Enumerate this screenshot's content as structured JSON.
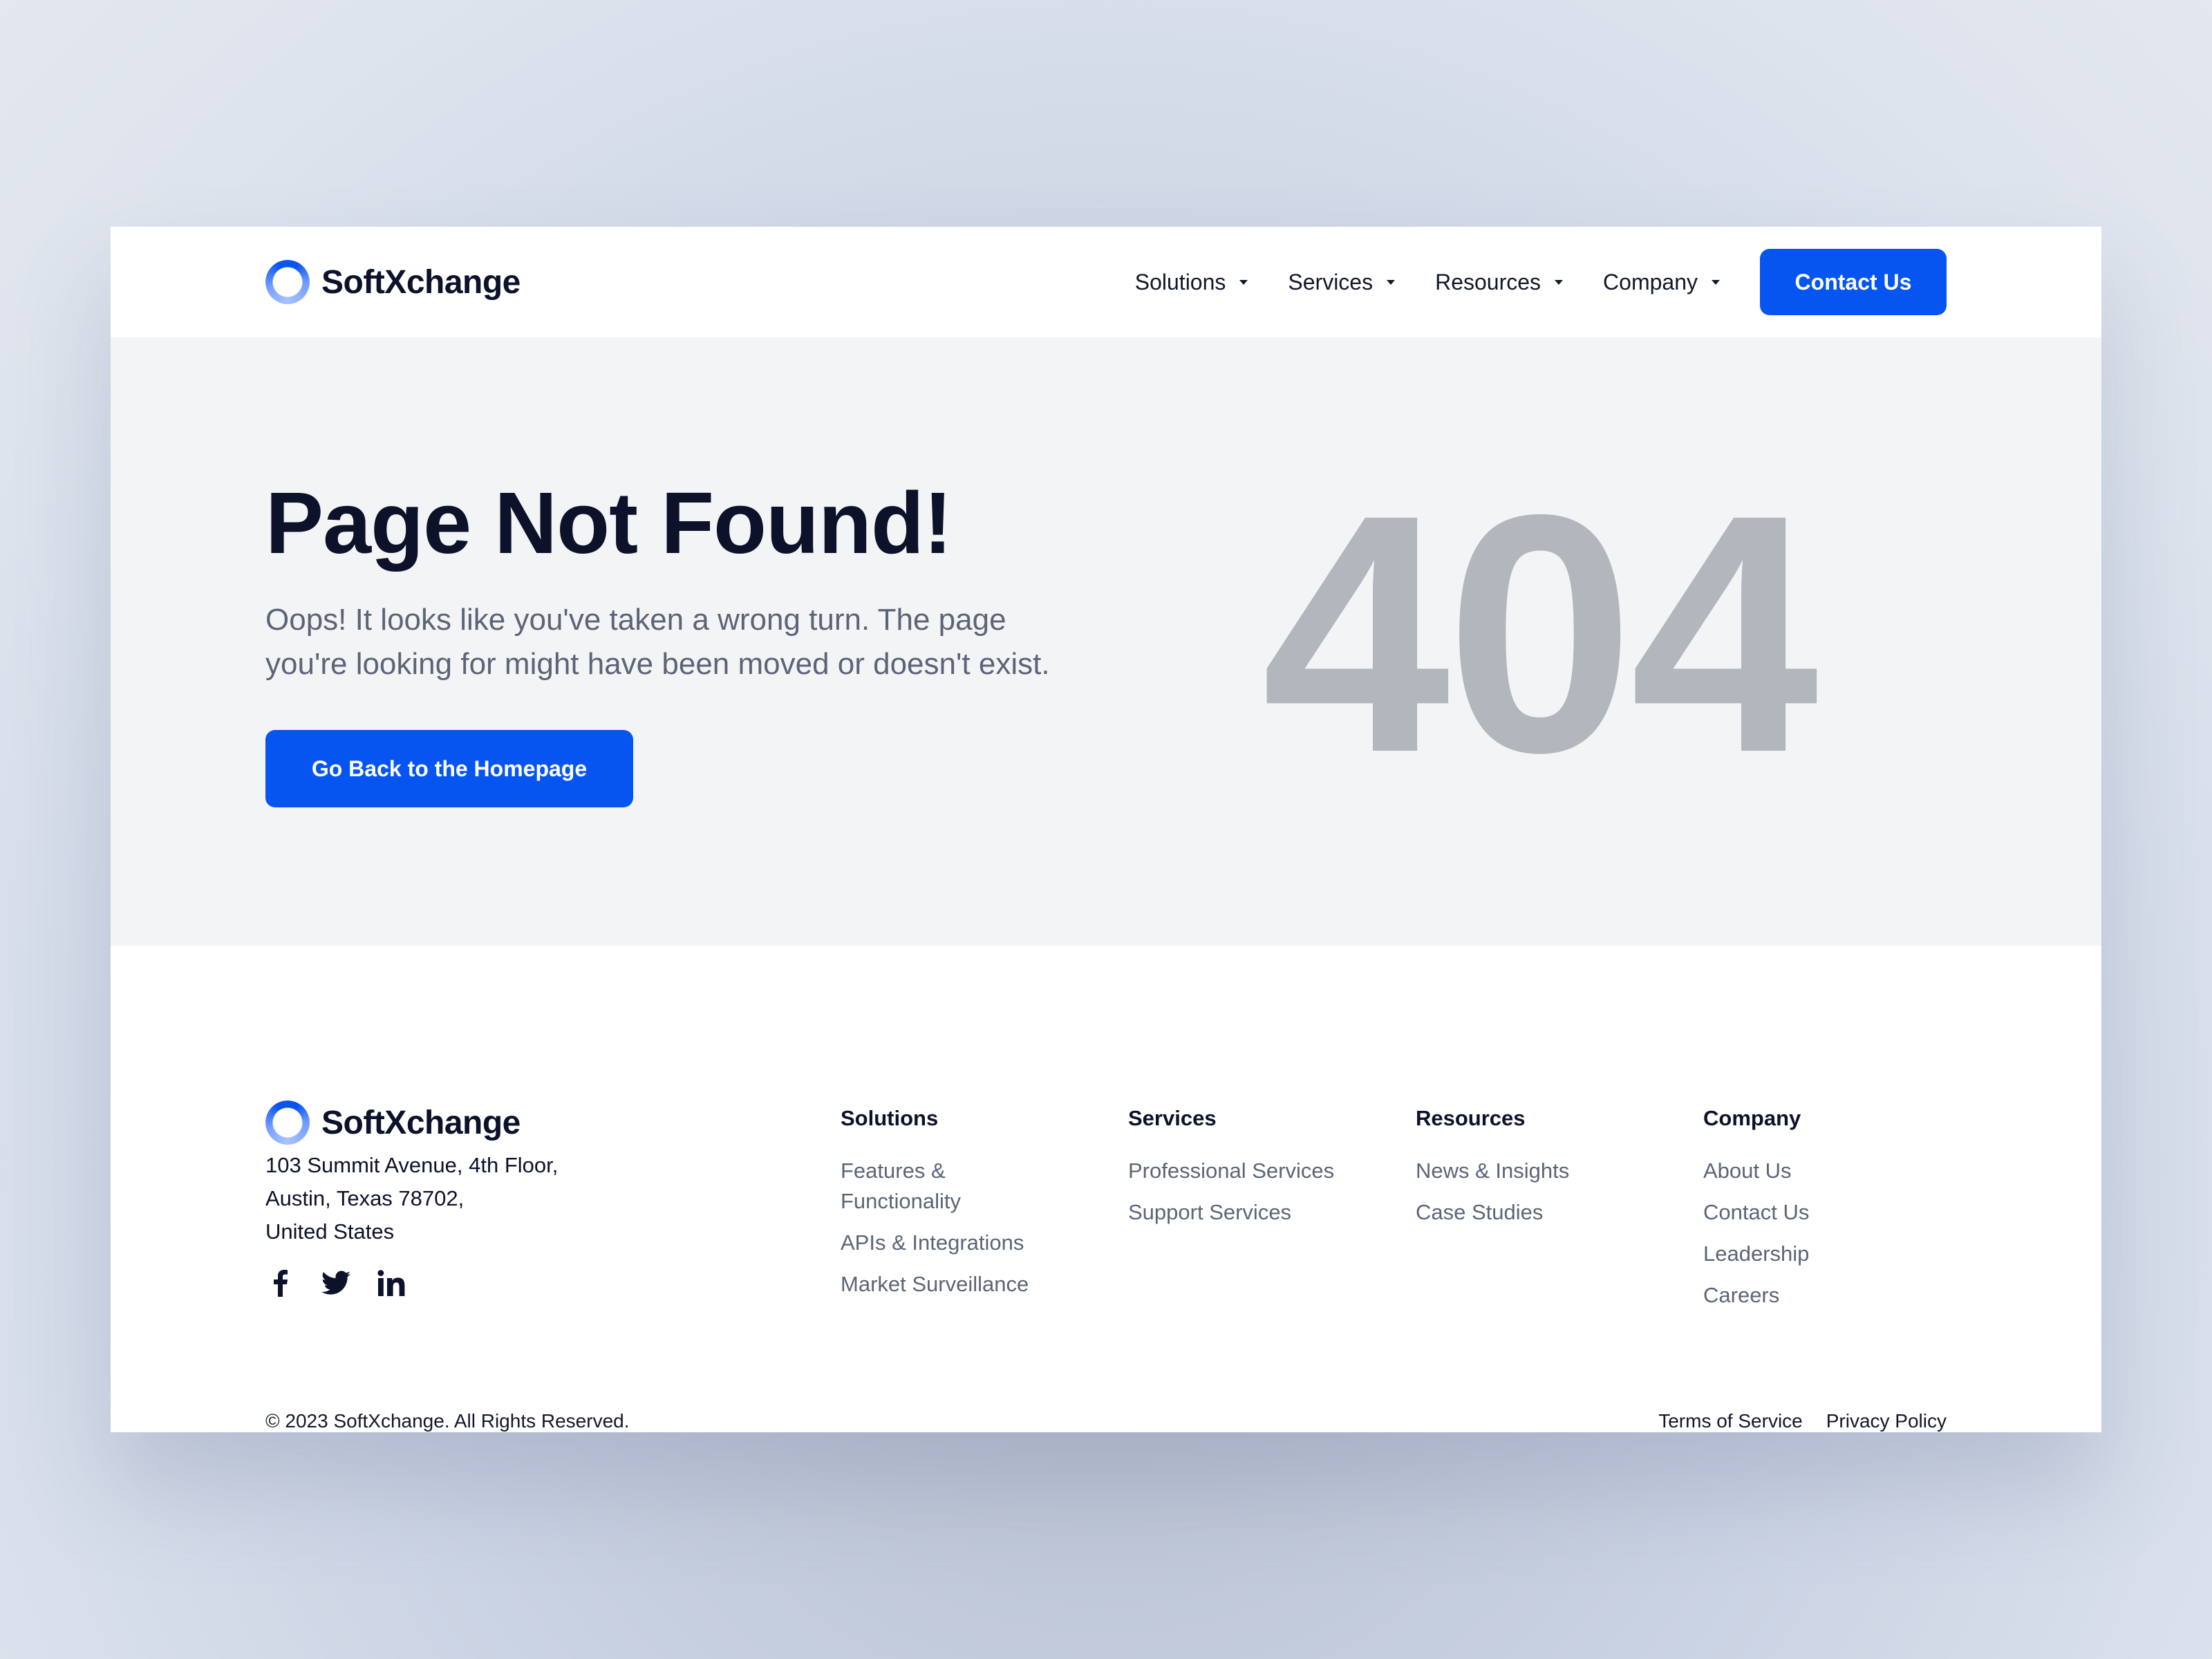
{
  "brand": {
    "name": "SoftXchange",
    "accent_color": "#0755f0",
    "logo_icon": "ring-logo-icon"
  },
  "nav": {
    "items": [
      {
        "label": "Solutions",
        "icon": "caret-down-icon"
      },
      {
        "label": "Services",
        "icon": "caret-down-icon"
      },
      {
        "label": "Resources",
        "icon": "caret-down-icon"
      },
      {
        "label": "Company",
        "icon": "caret-down-icon"
      }
    ],
    "cta_label": "Contact Us"
  },
  "hero": {
    "title": "Page Not Found!",
    "subtitle_line1": "Oops! It looks like you've taken a wrong turn. The page",
    "subtitle_line2": "you're looking for might have been moved or doesn't exist.",
    "button_label": "Go Back to the Homepage",
    "error_code": "404",
    "error_code_color": "#b2b7bd"
  },
  "footer": {
    "address": [
      "103 Summit Avenue, 4th Floor,",
      "Austin, Texas 78702,",
      "United States"
    ],
    "socials": [
      {
        "name": "facebook",
        "icon": "facebook-icon"
      },
      {
        "name": "twitter",
        "icon": "twitter-icon"
      },
      {
        "name": "linkedin",
        "icon": "linkedin-icon"
      }
    ],
    "columns": [
      {
        "heading": "Solutions",
        "links": [
          "Features & Functionality",
          "APIs & Integrations",
          "Market Surveillance"
        ]
      },
      {
        "heading": "Services",
        "links": [
          "Professional Services",
          "Support Services"
        ]
      },
      {
        "heading": "Resources",
        "links": [
          "News & Insights",
          "Case Studies"
        ]
      },
      {
        "heading": "Company",
        "links": [
          "About Us",
          "Contact Us",
          "Leadership",
          "Careers"
        ]
      }
    ],
    "copyright": "© 2023 SoftXchange. All Rights Reserved.",
    "legal_links": [
      "Terms of Service",
      "Privacy Policy"
    ]
  }
}
